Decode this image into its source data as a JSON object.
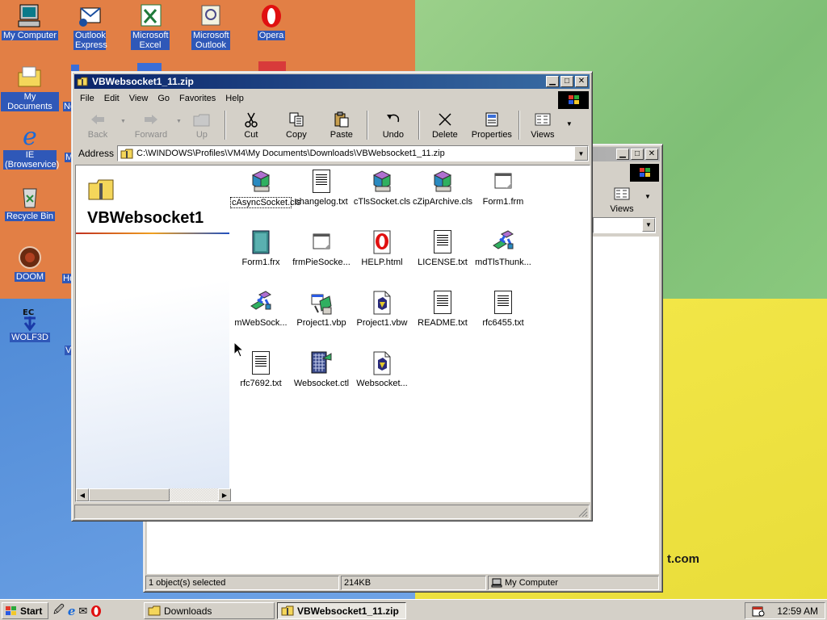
{
  "desktop": {
    "icons": [
      {
        "label": "My Computer"
      },
      {
        "label": "Outlook Express"
      },
      {
        "label": "Microsoft Excel"
      },
      {
        "label": "Microsoft Outlook"
      },
      {
        "label": "Opera"
      },
      {
        "label": "My Documents"
      },
      {
        "label": "IE (Browservice)"
      },
      {
        "label": "Recycle Bin"
      },
      {
        "label": "DOOM"
      },
      {
        "label": "WOLF3D"
      }
    ],
    "partial_labels": {
      "ne": "Ne",
      "he": "He",
      "vi": "Vi",
      "m": "M"
    },
    "wallpaper_text": "t.com"
  },
  "back_window": {
    "views_label": "Views",
    "status": {
      "selected": "1 object(s) selected",
      "size": "214KB",
      "zone": "My Computer"
    }
  },
  "main_window": {
    "title": "VBWebsocket1_11.zip",
    "menu": [
      "File",
      "Edit",
      "View",
      "Go",
      "Favorites",
      "Help"
    ],
    "toolbar": [
      {
        "label": "Back",
        "enabled": false
      },
      {
        "label": "Forward",
        "enabled": false
      },
      {
        "label": "Up",
        "enabled": false
      },
      {
        "label": "Cut",
        "enabled": true
      },
      {
        "label": "Copy",
        "enabled": true
      },
      {
        "label": "Paste",
        "enabled": true
      },
      {
        "label": "Undo",
        "enabled": true
      },
      {
        "label": "Delete",
        "enabled": true
      },
      {
        "label": "Properties",
        "enabled": true
      },
      {
        "label": "Views",
        "enabled": true
      }
    ],
    "address_label": "Address",
    "address_value": "C:\\WINDOWS\\Profiles\\VM4\\My Documents\\Downloads\\VBWebsocket1_11.zip",
    "folder_banner": "VBWebsocket1",
    "files": [
      {
        "name": "cAsyncSocket.cls",
        "icon": "class-module-icon",
        "selected": true
      },
      {
        "name": "changelog.txt",
        "icon": "text-file-icon"
      },
      {
        "name": "cTlsSocket.cls",
        "icon": "class-module-icon"
      },
      {
        "name": "cZipArchive.cls",
        "icon": "class-module-icon"
      },
      {
        "name": "Form1.frm",
        "icon": "form-file-icon"
      },
      {
        "name": "Form1.frx",
        "icon": "binary-file-icon"
      },
      {
        "name": "frmPieSocke...",
        "icon": "form-file-icon"
      },
      {
        "name": "HELP.html",
        "icon": "opera-html-icon"
      },
      {
        "name": "LICENSE.txt",
        "icon": "text-file-icon"
      },
      {
        "name": "mdTlsThunk...",
        "icon": "module-icon"
      },
      {
        "name": "mWebSock...",
        "icon": "module-icon"
      },
      {
        "name": "Project1.vbp",
        "icon": "vb-project-icon"
      },
      {
        "name": "Project1.vbw",
        "icon": "vb-workspace-icon"
      },
      {
        "name": "README.txt",
        "icon": "text-file-icon"
      },
      {
        "name": "rfc6455.txt",
        "icon": "text-file-icon"
      },
      {
        "name": "rfc7692.txt",
        "icon": "text-file-icon"
      },
      {
        "name": "Websocket.ctl",
        "icon": "user-control-icon"
      },
      {
        "name": "Websocket...",
        "icon": "vb-workspace-icon"
      }
    ]
  },
  "taskbar": {
    "start_label": "Start",
    "tasks": [
      {
        "label": "Downloads",
        "active": false
      },
      {
        "label": "VBWebsocket1_11.zip",
        "active": true
      }
    ],
    "clock": "12:59 AM"
  },
  "colors": {
    "title_active": "#0a246a",
    "face": "#d4d0c8",
    "icon_label_bg": "#2f58b8"
  }
}
